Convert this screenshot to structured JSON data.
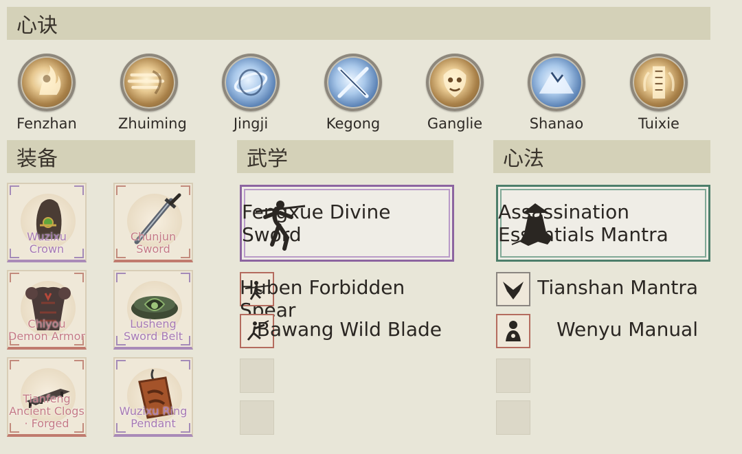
{
  "sections": {
    "xinjue": "心诀",
    "zhuangbei": "装备",
    "wuxue": "武学",
    "xinfa": "心法"
  },
  "skills": [
    {
      "name": "Fenzhan",
      "icon": "flame-warrior-icon",
      "tone": "gold"
    },
    {
      "name": "Zhuiming",
      "icon": "dash-icon",
      "tone": "gold"
    },
    {
      "name": "Jingji",
      "icon": "swirl-icon",
      "tone": "blue"
    },
    {
      "name": "Kegong",
      "icon": "crossed-blades-icon",
      "tone": "blue"
    },
    {
      "name": "Ganglie",
      "icon": "beast-face-icon",
      "tone": "gold"
    },
    {
      "name": "Shanao",
      "icon": "mountain-icon",
      "tone": "blue"
    },
    {
      "name": "Tuixie",
      "icon": "talisman-icon",
      "tone": "gold"
    }
  ],
  "equipment": [
    {
      "name": "Wuzixu Crown",
      "icon": "headgear-icon",
      "quality": "purple"
    },
    {
      "name": "Chunjun Sword",
      "icon": "sword-icon",
      "quality": "red"
    },
    {
      "name": "Chiyou Demon Armor",
      "icon": "armor-icon",
      "quality": "red"
    },
    {
      "name": "Lusheng Sword Belt",
      "icon": "belt-icon",
      "quality": "purple"
    },
    {
      "name": "Tianfeng Ancient Clogs · Forged",
      "icon": "clogs-icon",
      "quality": "red"
    },
    {
      "name": "Wuzixu Ring Pendant",
      "icon": "pendant-icon",
      "quality": "purple"
    }
  ],
  "wuxue": {
    "main": {
      "name": "Fengxue Divine Sword",
      "icon": "swordsman-icon"
    },
    "subs": [
      {
        "name": "Huben Forbidden Spear",
        "icon": "spearman-icon"
      },
      {
        "name": "Bawang Wild Blade",
        "icon": "blademan-icon"
      }
    ]
  },
  "xinfa": {
    "main": {
      "name": "Assassination Essentials Mantra",
      "icon": "assassin-icon"
    },
    "subs": [
      {
        "name": "Tianshan Mantra",
        "icon": "eagle-icon"
      },
      {
        "name": "Wenyu Manual",
        "icon": "monk-icon"
      }
    ]
  },
  "colors": {
    "background": "#e8e6d8",
    "section_bar": "#d4d1b8",
    "wuxue_border": "#8c64a0",
    "xinfa_border": "#4c7e6a",
    "rare_purple": "#a679b4",
    "rare_red": "#c47a86"
  }
}
